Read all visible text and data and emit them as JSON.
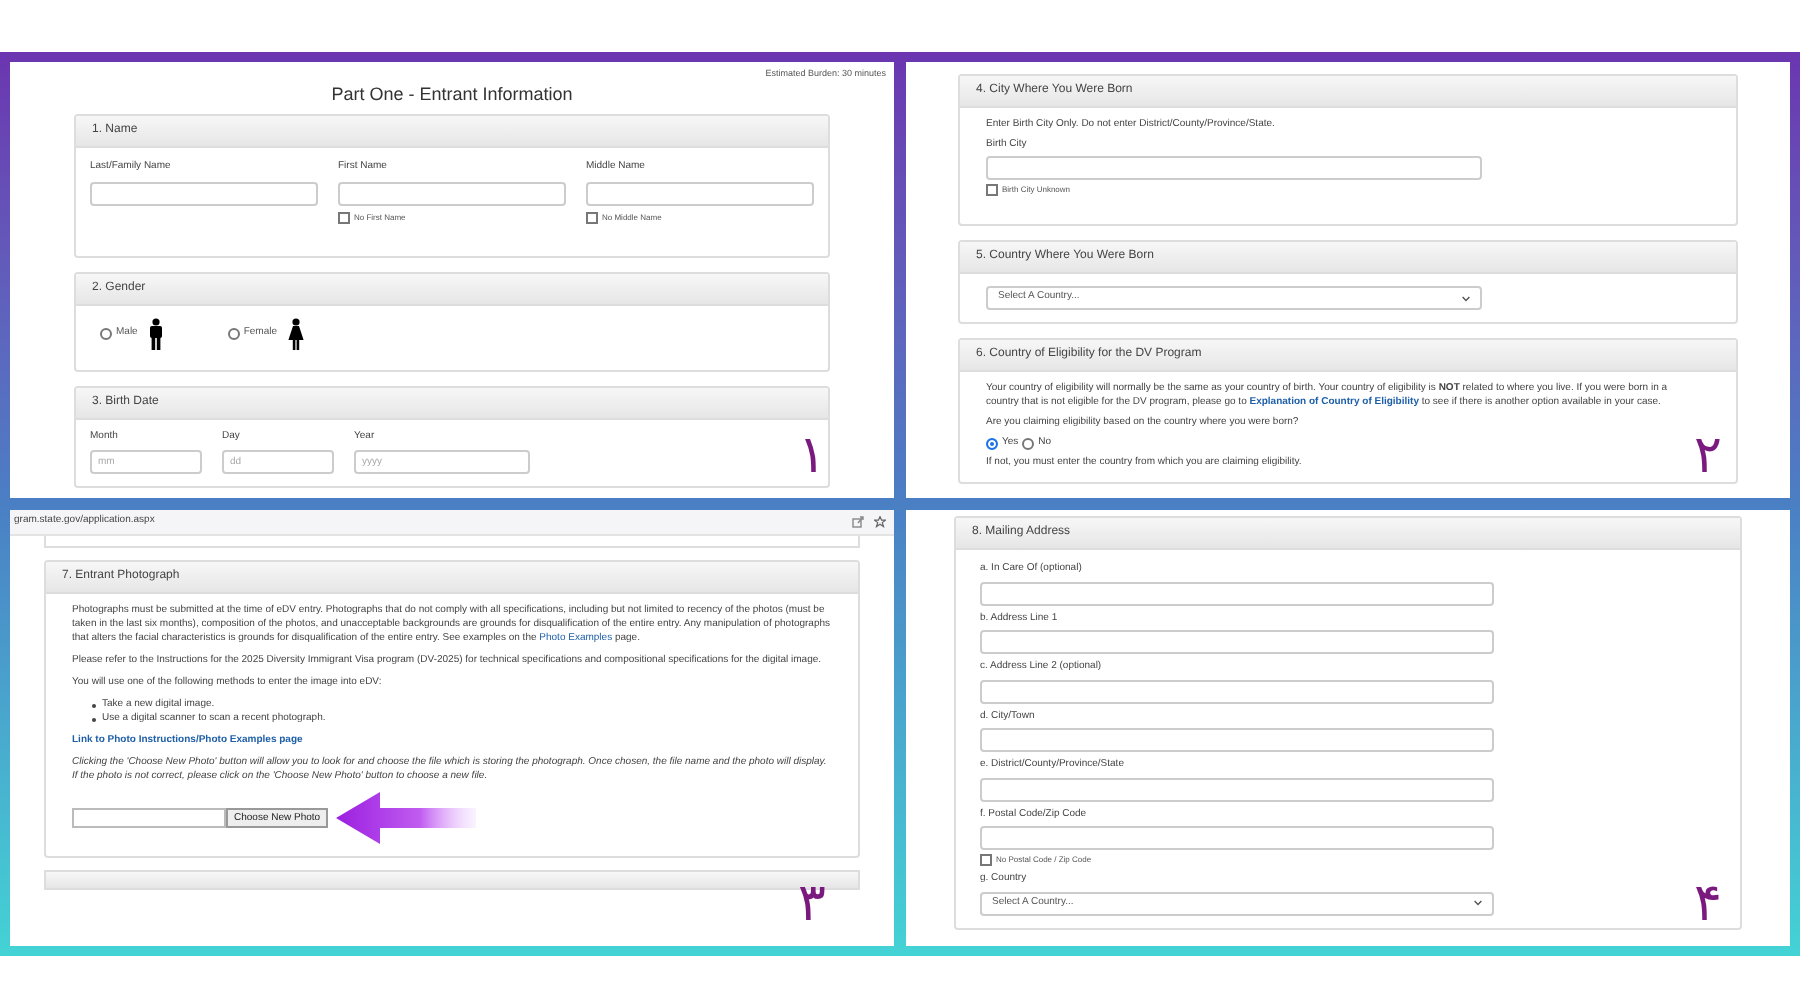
{
  "panel_1": {
    "burden": "Estimated Burden: 30 minutes",
    "title": "Part One - Entrant Information",
    "annotation": "۱",
    "name_section": {
      "heading": "1. Name",
      "fields": [
        {
          "label": "Last/Family Name"
        },
        {
          "label": "First Name",
          "checkbox": {
            "label": "No First Name",
            "checked": false
          }
        },
        {
          "label": "Middle Name",
          "checkbox": {
            "label": "No Middle Name",
            "checked": false
          }
        }
      ]
    },
    "gender_section": {
      "heading": "2. Gender",
      "options": [
        {
          "label": "Male",
          "kind": "male",
          "selected": false
        },
        {
          "label": "Female",
          "kind": "female",
          "selected": false
        }
      ]
    },
    "birth_date_section": {
      "heading": "3. Birth Date",
      "fields": [
        {
          "label": "Month",
          "placeholder": "mm"
        },
        {
          "label": "Day",
          "placeholder": "dd"
        },
        {
          "label": "Year",
          "placeholder": "yyyy"
        }
      ]
    }
  },
  "panel_2": {
    "annotation": "۲",
    "city_section": {
      "heading": "4. City Where You Were Born",
      "instruction": "Enter Birth City Only. Do not enter District/County/Province/State.",
      "label": "Birth City",
      "checkbox": {
        "label": "Birth City Unknown",
        "checked": false
      }
    },
    "country_section": {
      "heading": "5. Country Where You Were Born",
      "select": "Select A Country..."
    },
    "eligibility_section": {
      "heading": "6. Country of Eligibility for the DV Program",
      "text_before": "Your country of eligibility will normally be the same as your country of birth. Your country of eligibility is **NOT** related to where you live. If you were born in a country that is not eligible for the DV program, please go to",
      "link": "Explanation of Country of Eligibility",
      "text_after": "to see if there is another option available in your case.",
      "question": "Are you claiming eligibility based on the country where you were born?",
      "options": [
        {
          "label": "Yes",
          "selected": true
        },
        {
          "label": "No",
          "selected": false
        }
      ],
      "note": "If not, you must enter the country from which you are claiming eligibility."
    }
  },
  "panel_3": {
    "url": "gram.state.gov/application.aspx",
    "annotation": "۳",
    "photo_section": {
      "heading": "7. Entrant Photograph",
      "paragraph_1": "Photographs must be submitted at the time of eDV entry. Photographs that do not comply with all specifications, including but not limited to recency of the photos (must be taken in the last six months), composition of the photos, and unacceptable backgrounds are grounds for disqualification of the entire entry. Any manipulation of photographs that alters the facial characteristics is grounds for disqualification of the entire entry. See examples on the",
      "paragraph_1_link": "Photo Examples",
      "paragraph_1_end": "page.",
      "paragraph_2": "Please refer to the Instructions for the 2025 Diversity Immigrant Visa program (DV-2025) for technical specifications and compositional specifications for the digital image.",
      "paragraph_3": "You will use one of the following methods to enter the image into eDV:",
      "bullets": [
        "Take a new digital image.",
        "Use a digital scanner to scan a recent photograph."
      ],
      "link": "Link to Photo Instructions/Photo Examples page",
      "note": "Clicking the 'Choose New Photo' button will allow you to look for and choose the file which is storing the photograph. Once chosen, the file name and the photo will display. If the photo is not correct, please click on the 'Choose New Photo' button to choose a new file.",
      "button": "Choose New Photo"
    }
  },
  "panel_4": {
    "annotation": "۴",
    "address_section": {
      "heading": "8. Mailing Address",
      "fields": [
        {
          "label": "a. In Care Of (optional)",
          "kind": "text"
        },
        {
          "label": "b. Address Line 1",
          "kind": "text"
        },
        {
          "label": "c. Address Line 2 (optional)",
          "kind": "text"
        },
        {
          "label": "d. City/Town",
          "kind": "text"
        },
        {
          "label": "e. District/County/Province/State",
          "kind": "text"
        },
        {
          "label": "f. Postal Code/Zip Code",
          "kind": "text",
          "checkbox": {
            "label": "No Postal Code / Zip Code",
            "checked": false
          }
        },
        {
          "label": "g. Country",
          "kind": "select",
          "value": "Select A Country..."
        }
      ]
    }
  }
}
